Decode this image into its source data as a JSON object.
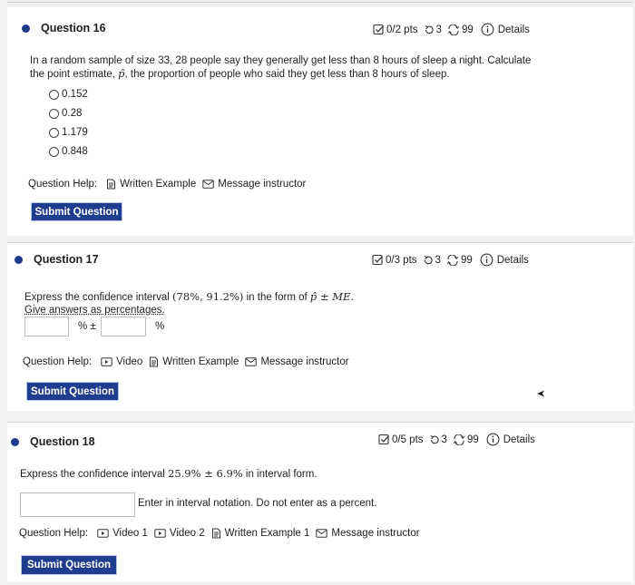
{
  "q16": {
    "title": "Question 16",
    "pts": "0/2 pts",
    "tries": "3",
    "subs": "99",
    "details": "Details",
    "line1": "In a random sample of size 33, 28 people say they generally get less than 8 hours of sleep a night. Calculate",
    "line2_a": "the point estimate, ",
    "phat": "p̂",
    "line2_b": ", the proportion of people who said they get less than 8 hours of sleep.",
    "options": [
      "0.152",
      "0.28",
      "1.179",
      "0.848"
    ],
    "help_label": "Question Help:",
    "help_links": [
      "Written Example",
      "Message instructor"
    ],
    "submit": "Submit Question"
  },
  "q17": {
    "title": "Question 17",
    "pts": "0/3 pts",
    "tries": "3",
    "subs": "99",
    "details": "Details",
    "line1_a": "Express the confidence interval ",
    "interval": "(78%, 91.2%)",
    "line1_b": " in the form of ",
    "form": "p̂ ± ME.",
    "line2": "Give answers as percentages.",
    "pm": "% ±",
    "pct": "%",
    "help_label": "Question Help:",
    "help_links": [
      "Video",
      "Written Example",
      "Message instructor"
    ],
    "submit": "Submit Question"
  },
  "q18": {
    "title": "Question 18",
    "pts": "0/5 pts",
    "tries": "3",
    "subs": "99",
    "details": "Details",
    "line1_a": "Express the confidence interval ",
    "interval": "25.9% ± 6.9%",
    "line1_b": " in interval form.",
    "hint": "Enter in interval notation. Do not enter as a percent.",
    "help_label": "Question Help:",
    "help_links": [
      "Video 1",
      "Video 2",
      "Written Example 1",
      "Message instructor"
    ],
    "submit": "Submit Question"
  },
  "colors": {
    "accent": "#1e3d8f",
    "bullet": "#1d3b8a"
  },
  "icons": [
    "checkbox-icon",
    "retry-icon",
    "submissions-icon",
    "info-icon",
    "document-icon",
    "envelope-icon",
    "video-icon",
    "cursor-icon"
  ]
}
